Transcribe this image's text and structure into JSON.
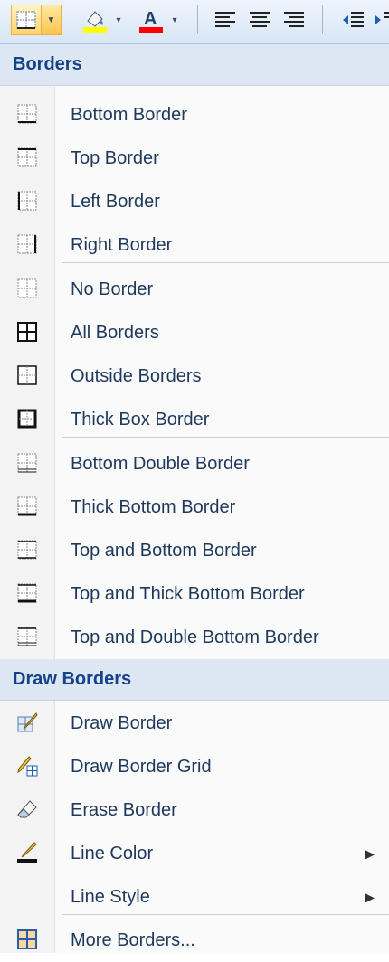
{
  "toolbar": {
    "buttons": [
      "borders-icon",
      "fill-color-icon",
      "font-color-icon",
      "align-left-icon",
      "align-center-icon",
      "align-right-icon",
      "decrease-indent-icon"
    ],
    "fill_color": "#ffff00",
    "font_color": "#ff0000",
    "font_letter": "A"
  },
  "menu": {
    "sections": [
      {
        "header": "Borders"
      },
      {
        "header": "Draw Borders"
      }
    ],
    "items": [
      {
        "label": "Bottom Border",
        "icon": "bottom-border-icon"
      },
      {
        "label": "Top Border",
        "icon": "top-border-icon"
      },
      {
        "label": "Left Border",
        "icon": "left-border-icon"
      },
      {
        "label": "Right Border",
        "icon": "right-border-icon"
      },
      {
        "label": "No Border",
        "icon": "no-border-icon"
      },
      {
        "label": "All Borders",
        "icon": "all-borders-icon"
      },
      {
        "label": "Outside Borders",
        "icon": "outside-borders-icon"
      },
      {
        "label": "Thick Box Border",
        "icon": "thick-box-border-icon"
      },
      {
        "label": "Bottom Double Border",
        "icon": "bottom-double-border-icon"
      },
      {
        "label": "Thick Bottom Border",
        "icon": "thick-bottom-border-icon"
      },
      {
        "label": "Top and Bottom Border",
        "icon": "top-bottom-border-icon"
      },
      {
        "label": "Top and Thick Bottom Border",
        "icon": "top-thick-bottom-border-icon"
      },
      {
        "label": "Top and Double Bottom Border",
        "icon": "top-double-bottom-border-icon"
      },
      {
        "label": "Draw Border",
        "icon": "draw-border-icon"
      },
      {
        "label": "Draw Border Grid",
        "icon": "draw-border-grid-icon"
      },
      {
        "label": "Erase Border",
        "icon": "eraser-icon"
      },
      {
        "label": "Line Color",
        "icon": "line-color-icon"
      },
      {
        "label": "Line Style",
        "icon": "line-style-icon"
      },
      {
        "label": "More Borders...",
        "icon": "more-borders-icon"
      }
    ],
    "submenu_arrow": "▶"
  }
}
